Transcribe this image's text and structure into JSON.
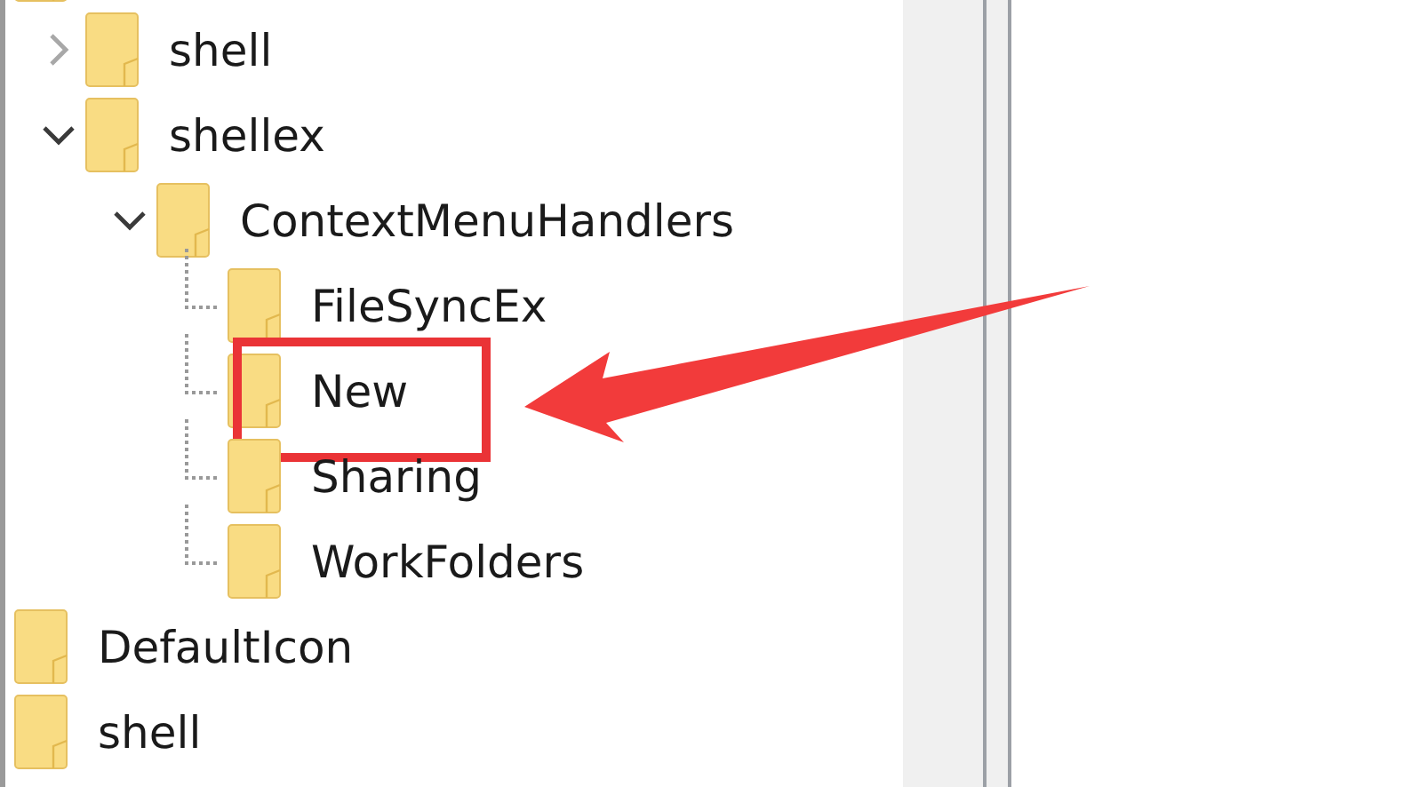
{
  "tree": [
    {
      "children": [
        {
          "label": "shell",
          "expanded": false,
          "highlighted": false
        },
        {
          "label": "shellex",
          "expanded": true,
          "highlighted": false,
          "children": [
            {
              "label": "ContextMenuHandlers",
              "expanded": true,
              "highlighted": false,
              "children": [
                {
                  "label": "FileSyncEx",
                  "highlighted": false
                },
                {
                  "label": "New",
                  "highlighted": true
                },
                {
                  "label": "Sharing",
                  "highlighted": false
                },
                {
                  "label": "WorkFolders",
                  "highlighted": false
                }
              ]
            }
          ]
        }
      ]
    },
    {
      "label": "DefaultIcon",
      "highlighted": false
    },
    {
      "label": "shell",
      "highlighted": false
    }
  ]
}
